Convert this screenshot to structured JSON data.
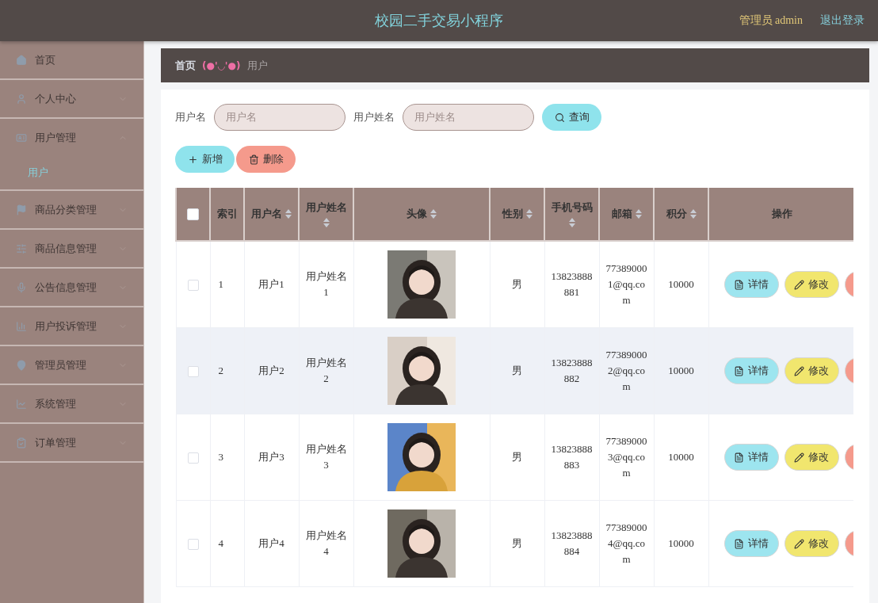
{
  "header": {
    "title": "校园二手交易小程序",
    "user": "管理员 admin",
    "logout": "退出登录"
  },
  "sidebar": {
    "items": [
      {
        "label": "首页",
        "has_arrow": false,
        "expanded": false
      },
      {
        "label": "个人中心",
        "has_arrow": true,
        "expanded": false
      },
      {
        "label": "用户管理",
        "has_arrow": true,
        "expanded": true,
        "children": [
          {
            "label": "用户",
            "selected": true
          }
        ]
      },
      {
        "label": "商品分类管理",
        "has_arrow": true,
        "expanded": false
      },
      {
        "label": "商品信息管理",
        "has_arrow": true,
        "expanded": false
      },
      {
        "label": "公告信息管理",
        "has_arrow": true,
        "expanded": false
      },
      {
        "label": "用户投诉管理",
        "has_arrow": true,
        "expanded": false
      },
      {
        "label": "管理员管理",
        "has_arrow": true,
        "expanded": false
      },
      {
        "label": "系统管理",
        "has_arrow": true,
        "expanded": false
      },
      {
        "label": "订单管理",
        "has_arrow": true,
        "expanded": false
      }
    ]
  },
  "breadcrumb": {
    "home": "首页",
    "separator": "(●'◡'●)",
    "current": "用户"
  },
  "search": {
    "fields": [
      {
        "label": "用户名",
        "placeholder": "用户名"
      },
      {
        "label": "用户姓名",
        "placeholder": "用户姓名"
      }
    ],
    "button": "查询"
  },
  "actions": [
    {
      "kind": "add",
      "label": "新增"
    },
    {
      "kind": "delete",
      "label": "删除"
    }
  ],
  "table": {
    "select_all_checked": false,
    "columns": [
      {
        "label": "索引",
        "sortable": false
      },
      {
        "label": "用户名",
        "sortable": true
      },
      {
        "label": "用户姓名",
        "sortable": true
      },
      {
        "label": "头像",
        "sortable": true
      },
      {
        "label": "性别",
        "sortable": true
      },
      {
        "label": "手机号码",
        "sortable": true
      },
      {
        "label": "邮箱",
        "sortable": true
      },
      {
        "label": "积分",
        "sortable": true
      },
      {
        "label": "操作",
        "sortable": false
      }
    ],
    "rows": [
      {
        "checked": false,
        "highlighted": false,
        "index": "1",
        "username": "用户1",
        "name": "用户姓名1",
        "gender": "男",
        "phone": "13823888881",
        "email": "773890001@qq.com",
        "points": "10000",
        "avatar": {
          "kind": "picture"
        },
        "actions": [
          {
            "kind": "detail",
            "label": "详情"
          },
          {
            "kind": "edit",
            "label": "修改"
          },
          {
            "kind": "delete"
          }
        ]
      },
      {
        "checked": false,
        "highlighted": true,
        "index": "2",
        "username": "用户2",
        "name": "用户姓名2",
        "gender": "男",
        "phone": "13823888882",
        "email": "773890002@qq.com",
        "points": "10000",
        "avatar": {
          "kind": "picture"
        },
        "actions": [
          {
            "kind": "detail",
            "label": "详情"
          },
          {
            "kind": "edit",
            "label": "修改"
          },
          {
            "kind": "delete"
          }
        ]
      },
      {
        "checked": false,
        "highlighted": false,
        "index": "3",
        "username": "用户3",
        "name": "用户姓名3",
        "gender": "男",
        "phone": "13823888883",
        "email": "773890003@qq.com",
        "points": "10000",
        "avatar": {
          "kind": "picture"
        },
        "actions": [
          {
            "kind": "detail",
            "label": "详情"
          },
          {
            "kind": "edit",
            "label": "修改"
          },
          {
            "kind": "delete"
          }
        ]
      },
      {
        "checked": false,
        "highlighted": false,
        "index": "4",
        "username": "用户4",
        "name": "用户姓名4",
        "gender": "男",
        "phone": "13823888884",
        "email": "773890004@qq.com",
        "points": "10000",
        "avatar": {
          "kind": "picture"
        },
        "actions": [
          {
            "kind": "detail",
            "label": "详情"
          },
          {
            "kind": "edit",
            "label": "修改"
          },
          {
            "kind": "delete"
          }
        ]
      }
    ]
  }
}
